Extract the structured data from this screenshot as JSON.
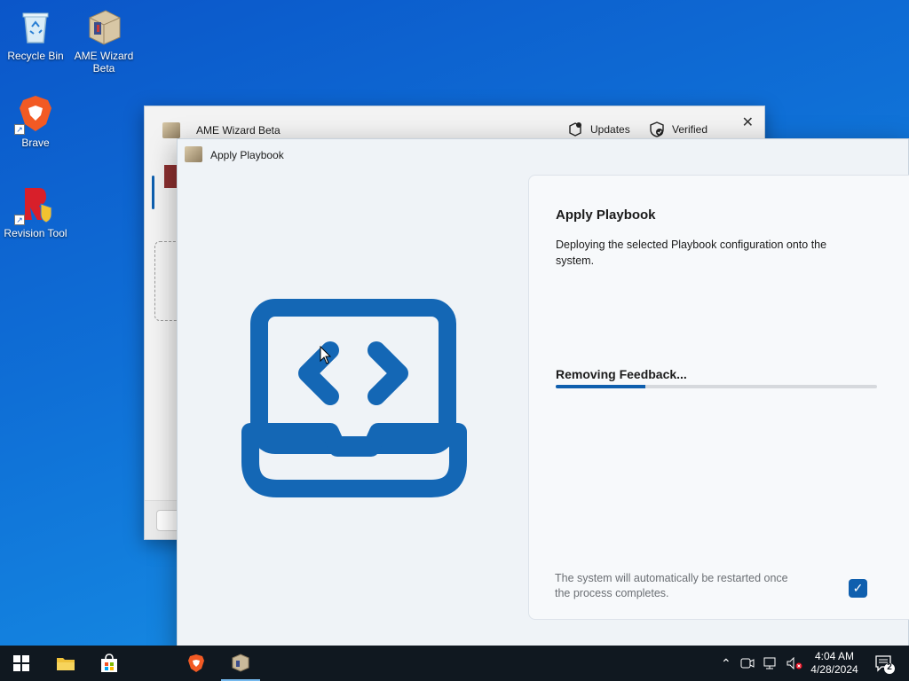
{
  "desktop": {
    "icons": [
      {
        "label": "Recycle Bin"
      },
      {
        "label": "AME Wizard Beta"
      },
      {
        "label": "Brave"
      },
      {
        "label": "Revision Tool"
      }
    ]
  },
  "background_window": {
    "title": "AME Wizard Beta",
    "updates_label": "Updates",
    "verified_label": "Verified",
    "close_glyph": "✕"
  },
  "dialog": {
    "title": "Apply Playbook",
    "panel": {
      "heading": "Apply Playbook",
      "description": "Deploying the selected Playbook configuration onto the system.",
      "status": "Removing Feedback...",
      "progress_fraction": 0.28,
      "restart_note": "The system will automatically be restarted once the process completes.",
      "restart_checked": true
    }
  },
  "taskbar": {
    "clock_time": "4:04 AM",
    "clock_date": "4/28/2024",
    "notification_count": "2"
  },
  "colors": {
    "accent": "#0f5fae",
    "illustration": "#1467b5",
    "taskbar": "#101820"
  }
}
